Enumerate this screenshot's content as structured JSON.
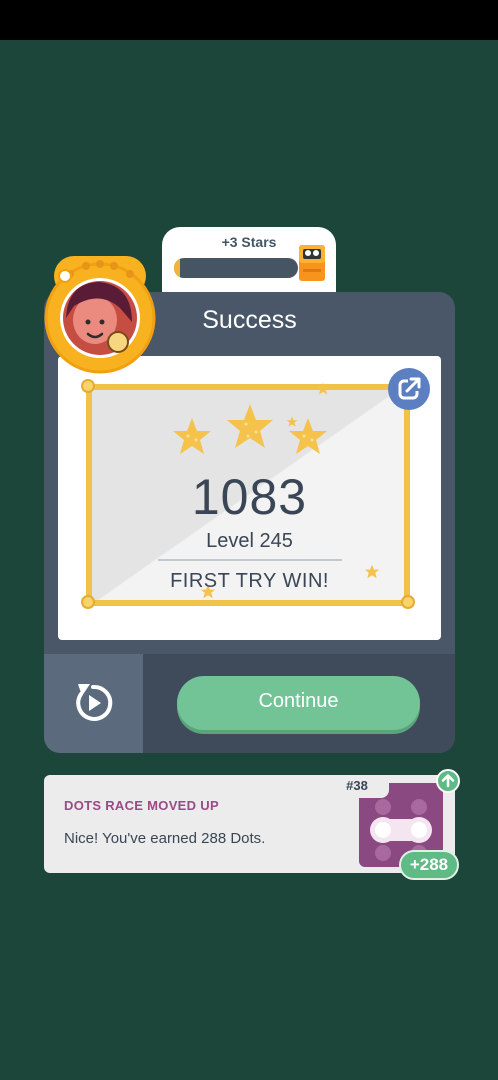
{
  "stars_reward": {
    "label": "+3 Stars",
    "progress_fraction": 0.05
  },
  "dialog": {
    "title": "Success",
    "score": "1083",
    "level": "Level 245",
    "result": "FIRST TRY WIN!",
    "continue_label": "Continue"
  },
  "race": {
    "title": "DOTS RACE MOVED UP",
    "message": "Nice! You've earned 288 Dots.",
    "rank": "#38",
    "dots_earned": "+288"
  },
  "colors": {
    "background": "#1c4639",
    "dialog": "#4a5768",
    "continue": "#72c497",
    "accent_gold": "#f2c14a",
    "race_title": "#9a4a86"
  },
  "icons": [
    "share-icon",
    "replay-icon",
    "star-icon",
    "arrow-up-icon",
    "treasure-box-icon"
  ]
}
